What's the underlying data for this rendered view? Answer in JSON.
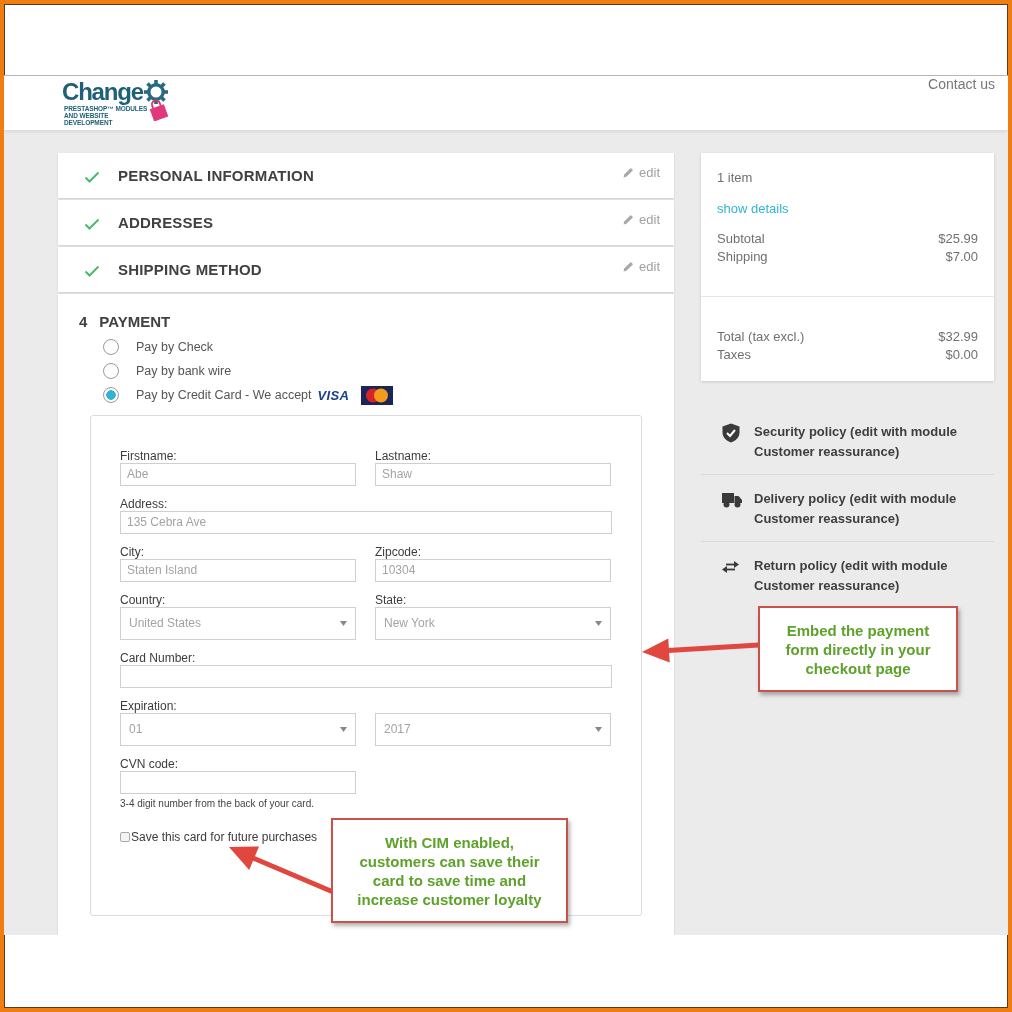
{
  "header": {
    "logo_text": "Change",
    "logo_tagline": "PRESTASHOP™ MODULES AND WEBSITE DEVELOPMENT",
    "contact_link": "Contact us"
  },
  "steps": [
    {
      "title": "PERSONAL INFORMATION",
      "complete": true,
      "edit_link": "edit"
    },
    {
      "title": "ADDRESSES",
      "complete": true,
      "edit_link": "edit"
    },
    {
      "title": "SHIPPING METHOD",
      "complete": true,
      "edit_link": "edit"
    }
  ],
  "payment": {
    "number": "4",
    "title": "PAYMENT",
    "options": [
      {
        "label": "Pay by Check",
        "selected": false
      },
      {
        "label": "Pay by bank wire",
        "selected": false
      },
      {
        "label": "Pay by Credit Card - We accept",
        "selected": true,
        "card_logos": [
          {
            "kind": "wordmark",
            "label": "VISA"
          },
          {
            "kind": "badge"
          }
        ]
      }
    ],
    "card_form": {
      "rows": [
        {
          "fields": [
            {
              "kind": "input",
              "label": "Firstname:",
              "value": "Abe"
            },
            {
              "kind": "input",
              "label": "Lastname:",
              "value": "Shaw"
            }
          ]
        },
        {
          "fields": [
            {
              "kind": "input",
              "label": "Address:",
              "value": "135 Cebra Ave",
              "wide": true
            }
          ]
        },
        {
          "fields": [
            {
              "kind": "input",
              "label": "City:",
              "value": "Staten Island"
            },
            {
              "kind": "input",
              "label": "Zipcode:",
              "value": "10304"
            }
          ]
        },
        {
          "fields": [
            {
              "kind": "select",
              "label": "Country:",
              "value": "United States"
            },
            {
              "kind": "select",
              "label": "State:",
              "value": "New York"
            }
          ]
        },
        {
          "fields": [
            {
              "kind": "input",
              "label": "Card Number:",
              "wide": true
            }
          ]
        },
        {
          "fields": [
            {
              "kind": "select",
              "label": "Expiration:",
              "value": "01"
            },
            {
              "kind": "select",
              "value": "2017"
            }
          ]
        },
        {
          "fields": [
            {
              "kind": "input",
              "label": "CVN code:",
              "hint": "3-4 digit number from the back of your card."
            }
          ]
        }
      ],
      "save_card": {
        "label": "Save this card for future purchases",
        "checked": false
      }
    }
  },
  "summary": {
    "item_count": "1 item",
    "details_link": "show details",
    "lines": [
      {
        "label": "Subtotal",
        "amount": "$25.99"
      },
      {
        "label": "Shipping",
        "amount": "$7.00"
      }
    ],
    "totals": [
      {
        "label": "Total (tax excl.)",
        "amount": "$32.99"
      },
      {
        "label": "Taxes",
        "amount": "$0.00"
      }
    ]
  },
  "reassurance": [
    {
      "kind": "shield",
      "text": "Security policy (edit with module Customer reassurance)"
    },
    {
      "kind": "truck",
      "text": "Delivery policy (edit with module Customer reassurance)"
    },
    {
      "kind": "arrows",
      "text": "Return policy (edit with module Customer reassurance)"
    }
  ],
  "annotations": [
    {
      "text": "Embed the payment form directly in your checkout page"
    },
    {
      "text": "With CIM enabled, customers can save their card to save time and increase customer loyalty"
    }
  ]
}
